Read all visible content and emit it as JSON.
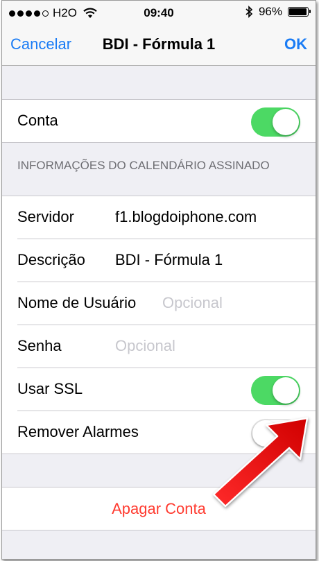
{
  "status_bar": {
    "carrier": "H2O",
    "time": "09:40",
    "battery_percent": "96%",
    "signal_bars_filled": 4,
    "icons": [
      "signal-dots-icon",
      "wifi-icon",
      "bluetooth-icon",
      "battery-icon"
    ]
  },
  "nav": {
    "cancel_label": "Cancelar",
    "title": "BDI - Fórmula 1",
    "ok_label": "OK"
  },
  "account": {
    "label": "Conta",
    "enabled": true
  },
  "section_header": "INFORMAÇÕES DO CALENDÁRIO ASSINADO",
  "fields": {
    "server": {
      "label": "Servidor",
      "value": "f1.blogdoiphone.com"
    },
    "description": {
      "label": "Descrição",
      "value": "BDI - Fórmula 1"
    },
    "username": {
      "label": "Nome de Usuário",
      "placeholder": "Opcional"
    },
    "password": {
      "label": "Senha",
      "placeholder": "Opcional"
    },
    "ssl": {
      "label": "Usar SSL",
      "enabled": true
    },
    "remove_alarms": {
      "label": "Remover Alarmes",
      "enabled": false
    }
  },
  "delete_label": "Apagar Conta",
  "colors": {
    "accent": "#1a7cf5",
    "toggle_on": "#4cd964",
    "destructive": "#ff3b30",
    "arrow": "#ff1010"
  }
}
